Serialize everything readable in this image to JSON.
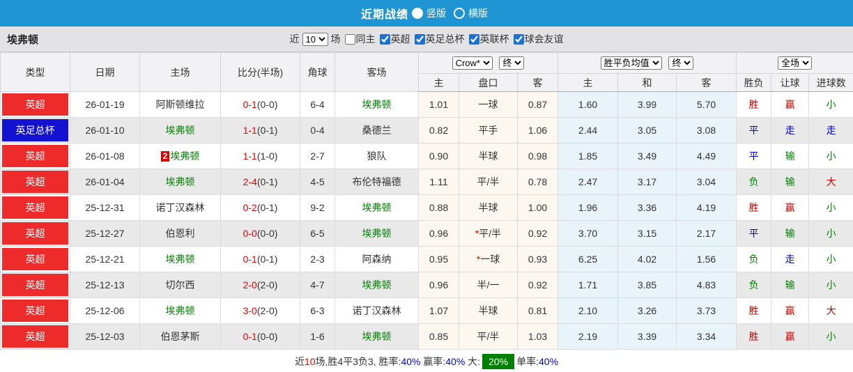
{
  "colors": {
    "topbar_blue": "#1E94D2",
    "league_red": "#EE2B2B",
    "cup_blue": "#1212D0",
    "team_green": "#008000",
    "score_red": "#E60000",
    "win_red": "#CC0000",
    "draw_blue": "#0000CC",
    "lose_green": "#008000",
    "odds_bg": "#FCF7EF",
    "avg_bg": "#E9F3FA",
    "badge_green": "#008000"
  },
  "topbar": {
    "title": "近期战绩",
    "radio_vertical": "竖版",
    "radio_horizontal": "横版"
  },
  "filter": {
    "team": "埃弗顿",
    "near_label": "近",
    "match_count": "10",
    "unit_label": "场",
    "same_home_label": "同主",
    "leagues": [
      "英超",
      "英足总杯",
      "英联杯",
      "球会友谊"
    ]
  },
  "header": {
    "cols": [
      "类型",
      "日期",
      "主场",
      "比分(半场)",
      "角球",
      "客场"
    ],
    "odds_select": "Crow*",
    "odds_final_select": "终",
    "avg_select": "胜平负均值",
    "avg_final_select": "终",
    "result_select": "全场",
    "odds_sub": [
      "主",
      "盘口",
      "客"
    ],
    "avg_sub": [
      "主",
      "和",
      "客"
    ],
    "result_sub": [
      "胜负",
      "让球",
      "进球数"
    ]
  },
  "rows": [
    {
      "league": "英超",
      "league_color": "red",
      "date": "26-01-19",
      "home": {
        "name": "阿斯顿维拉",
        "focus": false,
        "card": ""
      },
      "score": "0-1",
      "half": "(0-0)",
      "corner": "6-4",
      "away": {
        "name": "埃弗顿",
        "focus": true,
        "card": ""
      },
      "odds_home": "1.01",
      "handicap": "一球",
      "handicap_star": false,
      "odds_away": "0.87",
      "avg": [
        "1.60",
        "3.99",
        "5.70"
      ],
      "results": [
        [
          "胜",
          "red"
        ],
        [
          "赢",
          "red"
        ],
        [
          "小",
          "green"
        ]
      ]
    },
    {
      "league": "英足总杯",
      "league_color": "blue",
      "date": "26-01-10",
      "home": {
        "name": "埃弗顿",
        "focus": true,
        "card": ""
      },
      "score": "1-1",
      "half": "(0-1)",
      "corner": "0-4",
      "away": {
        "name": "桑德兰",
        "focus": false,
        "card": ""
      },
      "odds_home": "0.82",
      "handicap": "平手",
      "handicap_star": false,
      "odds_away": "1.06",
      "avg": [
        "2.44",
        "3.05",
        "3.08"
      ],
      "results": [
        [
          "平",
          "blue"
        ],
        [
          "走",
          "blue"
        ],
        [
          "走",
          "blue"
        ]
      ]
    },
    {
      "league": "英超",
      "league_color": "red",
      "date": "26-01-08",
      "home": {
        "name": "埃弗顿",
        "focus": true,
        "card": "2"
      },
      "score": "1-1",
      "half": "(1-0)",
      "corner": "2-7",
      "away": {
        "name": "狼队",
        "focus": false,
        "card": ""
      },
      "odds_home": "0.90",
      "handicap": "半球",
      "handicap_star": false,
      "odds_away": "0.98",
      "avg": [
        "1.85",
        "3.49",
        "4.49"
      ],
      "results": [
        [
          "平",
          "blue"
        ],
        [
          "输",
          "green"
        ],
        [
          "小",
          "green"
        ]
      ]
    },
    {
      "league": "英超",
      "league_color": "red",
      "date": "26-01-04",
      "home": {
        "name": "埃弗顿",
        "focus": true,
        "card": ""
      },
      "score": "2-4",
      "half": "(0-1)",
      "corner": "4-5",
      "away": {
        "name": "布伦特福德",
        "focus": false,
        "card": ""
      },
      "odds_home": "1.11",
      "handicap": "平/半",
      "handicap_star": false,
      "odds_away": "0.78",
      "avg": [
        "2.47",
        "3.17",
        "3.04"
      ],
      "results": [
        [
          "负",
          "green"
        ],
        [
          "输",
          "green"
        ],
        [
          "大",
          "red"
        ]
      ]
    },
    {
      "league": "英超",
      "league_color": "red",
      "date": "25-12-31",
      "home": {
        "name": "诺丁汉森林",
        "focus": false,
        "card": ""
      },
      "score": "0-2",
      "half": "(0-1)",
      "corner": "9-2",
      "away": {
        "name": "埃弗顿",
        "focus": true,
        "card": ""
      },
      "odds_home": "0.88",
      "handicap": "半球",
      "handicap_star": false,
      "odds_away": "1.00",
      "avg": [
        "1.96",
        "3.36",
        "4.19"
      ],
      "results": [
        [
          "胜",
          "red"
        ],
        [
          "赢",
          "red"
        ],
        [
          "小",
          "green"
        ]
      ]
    },
    {
      "league": "英超",
      "league_color": "red",
      "date": "25-12-27",
      "home": {
        "name": "伯恩利",
        "focus": false,
        "card": ""
      },
      "score": "0-0",
      "half": "(0-0)",
      "corner": "6-5",
      "away": {
        "name": "埃弗顿",
        "focus": true,
        "card": ""
      },
      "odds_home": "0.96",
      "handicap": "平/半",
      "handicap_star": true,
      "odds_away": "0.92",
      "avg": [
        "3.70",
        "3.15",
        "2.17"
      ],
      "results": [
        [
          "平",
          "blue"
        ],
        [
          "输",
          "green"
        ],
        [
          "小",
          "green"
        ]
      ]
    },
    {
      "league": "英超",
      "league_color": "red",
      "date": "25-12-21",
      "home": {
        "name": "埃弗顿",
        "focus": true,
        "card": ""
      },
      "score": "0-1",
      "half": "(0-1)",
      "corner": "2-3",
      "away": {
        "name": "阿森纳",
        "focus": false,
        "card": ""
      },
      "odds_home": "0.95",
      "handicap": "一球",
      "handicap_star": true,
      "odds_away": "0.93",
      "avg": [
        "6.25",
        "4.02",
        "1.56"
      ],
      "results": [
        [
          "负",
          "green"
        ],
        [
          "走",
          "blue"
        ],
        [
          "小",
          "green"
        ]
      ]
    },
    {
      "league": "英超",
      "league_color": "red",
      "date": "25-12-13",
      "home": {
        "name": "切尔西",
        "focus": false,
        "card": ""
      },
      "score": "2-0",
      "half": "(2-0)",
      "corner": "4-7",
      "away": {
        "name": "埃弗顿",
        "focus": true,
        "card": ""
      },
      "odds_home": "0.96",
      "handicap": "半/一",
      "handicap_star": false,
      "odds_away": "0.92",
      "avg": [
        "1.71",
        "3.85",
        "4.83"
      ],
      "results": [
        [
          "负",
          "green"
        ],
        [
          "输",
          "green"
        ],
        [
          "小",
          "green"
        ]
      ]
    },
    {
      "league": "英超",
      "league_color": "red",
      "date": "25-12-06",
      "home": {
        "name": "埃弗顿",
        "focus": true,
        "card": ""
      },
      "score": "3-0",
      "half": "(2-0)",
      "corner": "6-3",
      "away": {
        "name": "诺丁汉森林",
        "focus": false,
        "card": ""
      },
      "odds_home": "1.07",
      "handicap": "半球",
      "handicap_star": false,
      "odds_away": "0.81",
      "avg": [
        "2.10",
        "3.26",
        "3.73"
      ],
      "results": [
        [
          "胜",
          "red"
        ],
        [
          "赢",
          "red"
        ],
        [
          "大",
          "red"
        ]
      ]
    },
    {
      "league": "英超",
      "league_color": "red",
      "date": "25-12-03",
      "home": {
        "name": "伯恩茅斯",
        "focus": false,
        "card": ""
      },
      "score": "0-1",
      "half": "(0-0)",
      "corner": "1-6",
      "away": {
        "name": "埃弗顿",
        "focus": true,
        "card": ""
      },
      "odds_home": "0.85",
      "handicap": "平/半",
      "handicap_star": false,
      "odds_away": "1.03",
      "avg": [
        "2.19",
        "3.39",
        "3.34"
      ],
      "results": [
        [
          "胜",
          "red"
        ],
        [
          "赢",
          "red"
        ],
        [
          "小",
          "green"
        ]
      ]
    }
  ],
  "summary": {
    "segments": [
      {
        "text": "近",
        "style": "plain"
      },
      {
        "text": "10",
        "style": "red"
      },
      {
        "text": "场,胜4平3负3, 胜率:",
        "style": "plain"
      },
      {
        "text": "40%",
        "style": "blue"
      },
      {
        "text": " 赢率:",
        "style": "plain"
      },
      {
        "text": "40%",
        "style": "blue"
      },
      {
        "text": " 大:",
        "style": "plain"
      },
      {
        "text": "20%",
        "style": "badge"
      },
      {
        "text": "单率:",
        "style": "plain"
      },
      {
        "text": "40%",
        "style": "blue"
      }
    ]
  }
}
